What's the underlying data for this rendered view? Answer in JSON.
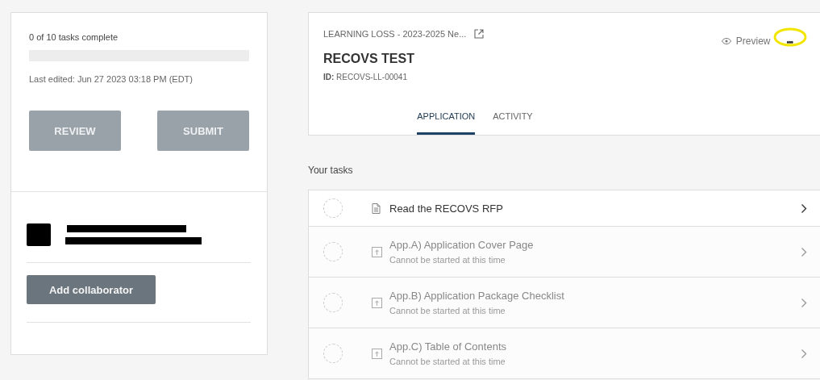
{
  "progress": {
    "label": "0 of 10 tasks complete",
    "level": 0
  },
  "last_edited": "Last edited: Jun 27 2023 03:18 PM (EDT)",
  "actions": [
    {
      "label": "REVIEW",
      "disabled": true
    },
    {
      "label": "SUBMIT",
      "disabled": true
    }
  ],
  "collaborator_button": "Add collaborator",
  "header": {
    "breadcrumb": "LEARNING LOSS - 2023-2025 Ne...",
    "title": "RECOVS TEST",
    "id_label": "ID:",
    "id_value": "RECOVS-LL-00041",
    "preview": "Preview",
    "more": "•••"
  },
  "tabs": [
    {
      "label": "APPLICATION",
      "selected": true
    },
    {
      "label": "ACTIVITY",
      "selected": false
    }
  ],
  "tasks_heading": "Your tasks",
  "tasks": [
    {
      "kind": "document",
      "title": "Read the RECOVS RFP",
      "disabled": false
    },
    {
      "kind": "upload",
      "title": "App.A) Application Cover Page",
      "note": "Cannot be started at this time",
      "disabled": true
    },
    {
      "kind": "upload",
      "title": "App.B) Application Package Checklist",
      "note": "Cannot be started at this time",
      "disabled": true
    },
    {
      "kind": "upload",
      "title": "App.C) Table of Contents",
      "note": "Cannot be started at this time",
      "disabled": true
    }
  ]
}
